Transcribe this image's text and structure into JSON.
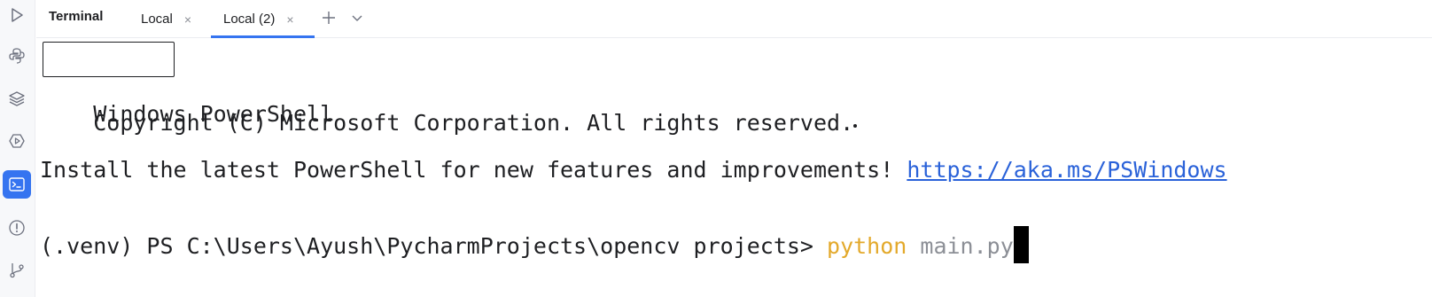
{
  "toolwindow": {
    "title": "Terminal",
    "tabs": [
      {
        "label": "Local",
        "active": false
      },
      {
        "label": "Local (2)",
        "active": true
      }
    ],
    "new_tab_icon": "plus-icon",
    "more_tabs_icon": "chevron-down-icon",
    "close_glyph": "×"
  },
  "sidebar": {
    "icons": [
      "run-icon",
      "python-console-icon",
      "layers-icon",
      "services-icon",
      "terminal-icon",
      "problems-icon",
      "git-icon"
    ],
    "active": "terminal-icon"
  },
  "terminal": {
    "line1": "Windows PowerShell",
    "line2": "Copyright (C) Microsoft Corporation. All rights reserved.",
    "line3_text": "Install the latest PowerShell for new features and improvements! ",
    "line3_link": "https://aka.ms/PSWindows",
    "prompt": "(.venv) PS C:\\Users\\Ayush\\PycharmProjects\\opencv projects> ",
    "command": "python",
    "argument": " main.py"
  },
  "colors": {
    "accent": "#3574f0",
    "link": "#2a62d9",
    "command": "#e3a92b",
    "argument": "#8c8f96"
  }
}
